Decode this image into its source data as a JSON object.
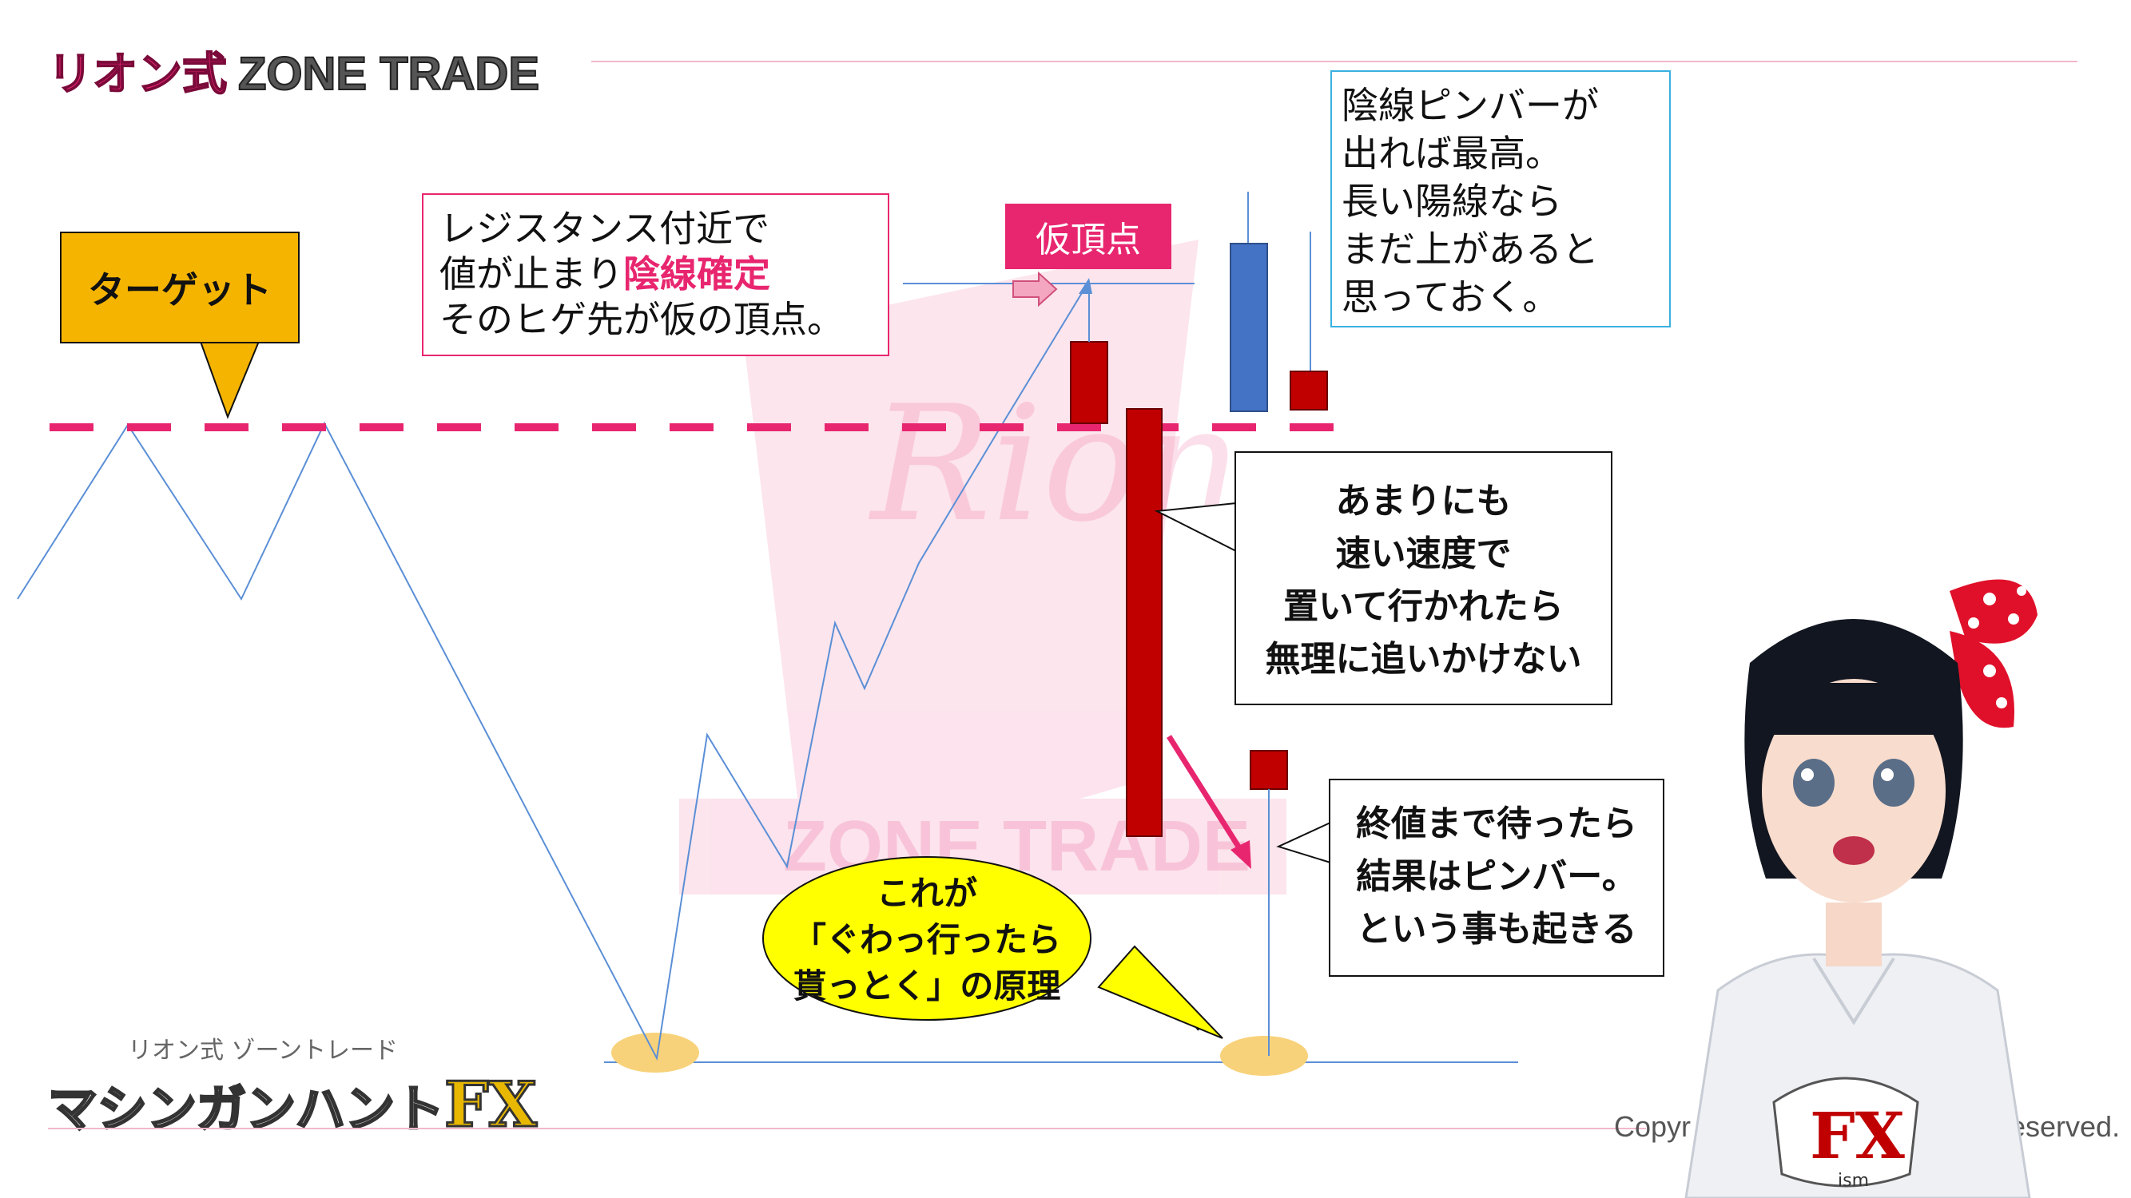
{
  "header": {
    "brand_pink": "リオン式",
    "brand_dark": "ZONE TRADE"
  },
  "target_label": "ターゲット",
  "kari_label": "仮頂点",
  "resistance_note": {
    "line1": "レジスタンス付近で",
    "line2_a": "値が止まり",
    "line2_b": "陰線確定",
    "line3": "そのヒゲ先が仮の頂点。"
  },
  "pinbar_note": [
    "陰線ピンバーが",
    "出れば最高。",
    "長い陽線なら",
    "まだ上があると",
    "思っておく。"
  ],
  "speed_note": [
    "あまりにも",
    "速い速度で",
    "置いて行かれたら",
    "無理に追いかけない"
  ],
  "close_note": [
    "終値まで待ったら",
    "結果はピンバー。",
    "という事も起きる"
  ],
  "yellow_bubble": [
    "これが",
    "「ぐわっ行ったら",
    "貰っとく」の原理"
  ],
  "bottom_logo": {
    "small": "リオン式  ゾーントレード",
    "big_jp": "マシンガンハント",
    "big_fx": "FX"
  },
  "copyright": {
    "left": "Copyr",
    "right": "s reserved."
  },
  "character_shirt": {
    "logo": "FX",
    "sub": "ism"
  },
  "watermark": {
    "text1": "Rion",
    "text2": "ZONE TRADE"
  },
  "colors": {
    "accent_pink": "#e8266f",
    "bear_red": "#c00000",
    "bull_blue": "#4472c4",
    "line_blue": "#5b8fd6",
    "target_fill": "#f5b400",
    "bubble_yellow": "#ffff00",
    "kari_fill": "#e8266f"
  }
}
